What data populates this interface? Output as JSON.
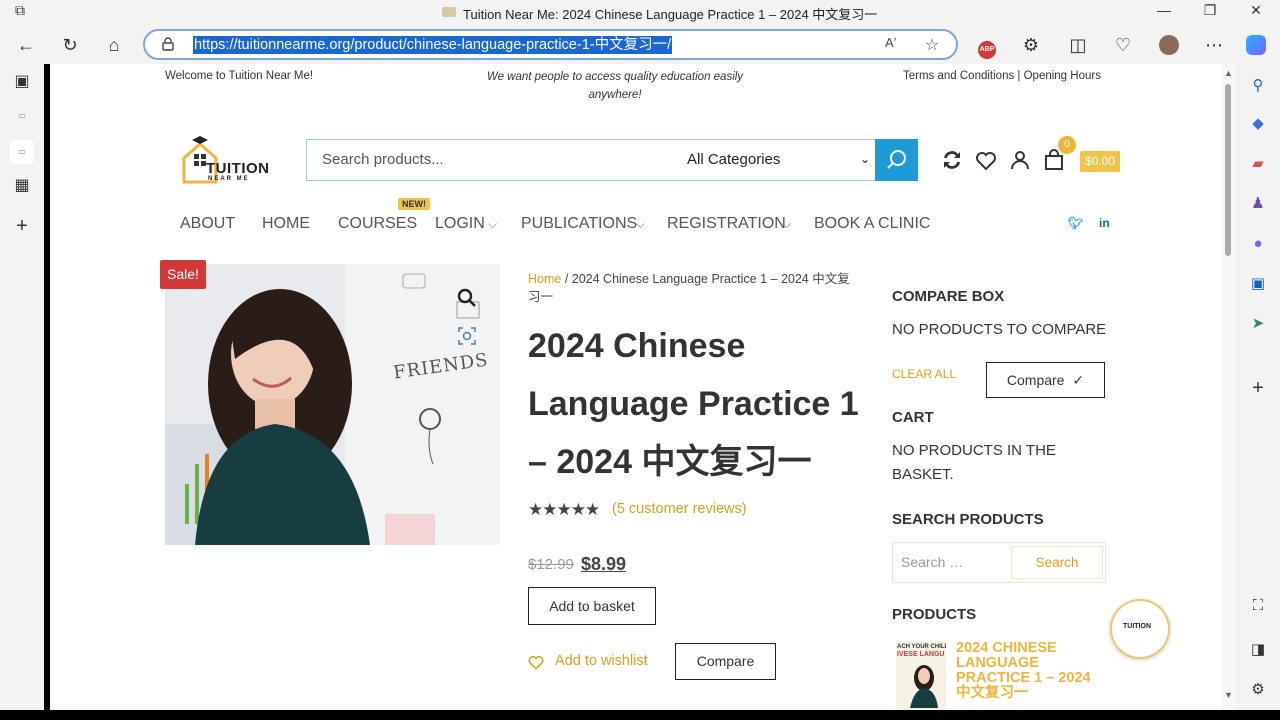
{
  "browser": {
    "tab_title": "Tuition Near Me: 2024 Chinese Language Practice 1 – 2024 中文复习一",
    "url": "https://tuitionnearme.org/product/chinese-language-practice-1-中文复习一/",
    "abp_label": "ABP"
  },
  "topbar": {
    "welcome": "Welcome to Tuition Near Me!",
    "tagline": "We want people to access quality education easily anywhere!",
    "links": "Terms and Conditions | Opening Hours"
  },
  "header": {
    "logo_text": "TUITION",
    "logo_sub": "NEAR ME",
    "search_placeholder": "Search products...",
    "category": "All Categories",
    "cart_count": "0",
    "cart_total": "$0.00"
  },
  "nav": {
    "about": "ABOUT",
    "home": "HOME",
    "courses": "COURSES",
    "new_badge": "NEW!",
    "login": "LOGIN",
    "publications": "PUBLICATIONS",
    "registration": "REGISTRATION",
    "book_clinic": "BOOK A CLINIC"
  },
  "product": {
    "sale_badge": "Sale!",
    "breadcrumb_home": "Home",
    "breadcrumb_rest": " / 2024 Chinese Language Practice 1 – 2024 中文复习一",
    "title": "2024 Chinese Language Practice 1 – 2024 中文复习一",
    "rating": 4.8,
    "reviews": "(5 customer reviews)",
    "old_price": "$12.99",
    "new_price": "$8.99",
    "add_to_basket": "Add to basket",
    "add_to_wishlist": "Add to wishlist",
    "compare": "Compare",
    "image_text": "FRIENDS"
  },
  "sidebar": {
    "compare_heading": "COMPARE BOX",
    "compare_empty": "NO PRODUCTS TO COMPARE",
    "clear_all": "CLEAR ALL",
    "compare_button": "Compare",
    "cart_heading": "CART",
    "cart_empty": "NO PRODUCTS IN THE BASKET.",
    "search_heading": "SEARCH PRODUCTS",
    "search_placeholder": "Search …",
    "search_button": "Search",
    "products_heading": "PRODUCTS",
    "product_title": "2024 CHINESE LANGUAGE PRACTICE 1 – 2024 中文复习一",
    "thumb_line1": "ACH YOUR CHILDRI",
    "thumb_line2": "IVESE LANGU"
  },
  "colors": {
    "accent_gold": "#d4a017",
    "search_blue": "#1e9ad6",
    "sale_red": "#d33838"
  }
}
